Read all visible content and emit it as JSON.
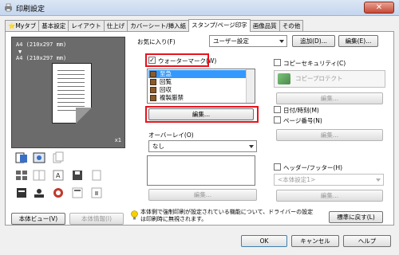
{
  "window": {
    "title": "印刷設定",
    "close_label": "✕"
  },
  "tabs": [
    "Myタブ",
    "基本設定",
    "レイアウト",
    "仕上げ",
    "カバーシート/挿入紙",
    "スタンプ/ページ印字",
    "画像品質",
    "その他"
  ],
  "active_tab_index": 5,
  "preview": {
    "paper_line1": "A4 (210x297 mm)",
    "arrow": "▼",
    "paper_line2": "A4 (210x297 mm)",
    "copies": "x1"
  },
  "bottom_left_buttons": {
    "body_view": "本体ビュー(V)",
    "body_info": "本体情報(I)"
  },
  "favorites": {
    "label": "お気に入り(F)",
    "value": "ユーザー設定",
    "add_label": "追加(D)...",
    "edit_label": "編集(E)..."
  },
  "watermark": {
    "checkbox_label": "ウォーターマーク(W)",
    "checked": true,
    "items": [
      "至急",
      "回覧",
      "回収",
      "複製厳禁"
    ],
    "selected_index": 0,
    "edit_label": "編集..."
  },
  "overlay": {
    "label": "オーバーレイ(O)",
    "value": "なし",
    "edit_label": "編集..."
  },
  "copy_security": {
    "label": "コピーセキュリティ(C)",
    "option": "コピープロテクト",
    "edit_label": "編集..."
  },
  "datetime": {
    "label": "日付/時刻(M)"
  },
  "page_number": {
    "label": "ページ番号(N)",
    "edit_label": "編集..."
  },
  "header_footer": {
    "label": "ヘッダー/フッター(H)",
    "value": "<本体設定1>",
    "edit_label": "編集..."
  },
  "info_text": "本体側で強制印刷が設定されている機能について、ドライバーの設定は印刷時に無視されます。",
  "restore_label": "標準に戻す(L)",
  "footer": {
    "ok": "OK",
    "cancel": "キャンセル",
    "help": "ヘルプ"
  },
  "colors": {
    "highlight_red": "#e8121c",
    "selection_blue": "#3399ff",
    "preview_bg": "#6b6b6b"
  }
}
